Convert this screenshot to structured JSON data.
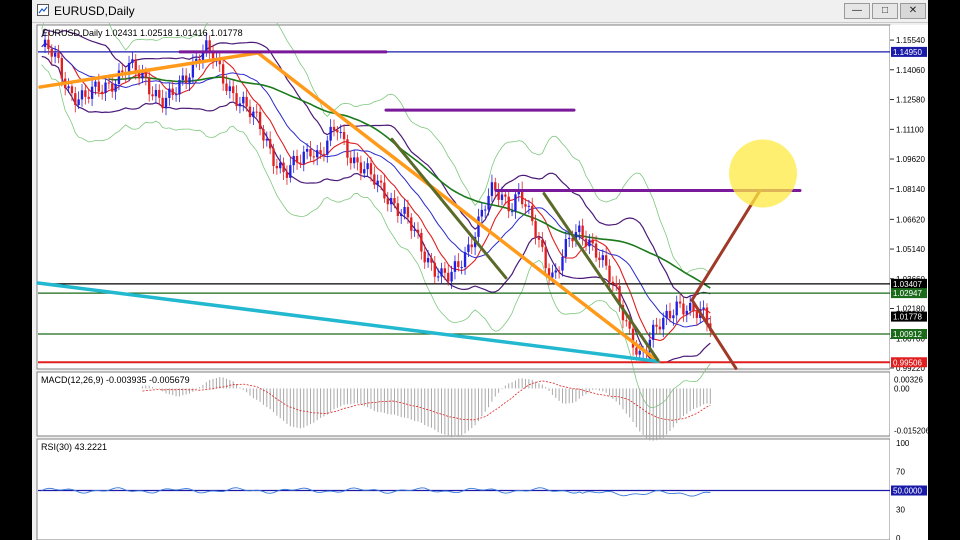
{
  "window": {
    "title": "EURUSD,Daily",
    "buttons": {
      "minimize": "—",
      "restore": "□",
      "close": "✕"
    }
  },
  "chart_data": {
    "type": "candlestick",
    "symbol_header": "EURUSD,Daily  1.02431 1.02518 1.01416 1.01778",
    "price_axis": {
      "ticks": [
        "1.15540",
        "1.14060",
        "1.12580",
        "1.11100",
        "1.09620",
        "1.08140",
        "1.06620",
        "1.05140",
        "1.03660",
        "1.02180",
        "1.00700",
        "0.99220"
      ],
      "range": [
        0.9922,
        1.1604
      ]
    },
    "price_labels": [
      {
        "value": 1.1495,
        "text": "1.14950",
        "color": "#1a1aa8"
      },
      {
        "value": 1.03407,
        "text": "1.03407",
        "color": "#000000"
      },
      {
        "value": 1.02947,
        "text": "1.02947",
        "color": "#1a6a1a"
      },
      {
        "value": 1.01778,
        "text": "1.01778",
        "color": "#000000"
      },
      {
        "value": 1.00912,
        "text": "1.00912",
        "color": "#1a6a1a"
      },
      {
        "value": 0.99506,
        "text": "0.99506",
        "color": "#e02020"
      }
    ],
    "horizontal_lines": [
      {
        "value": 1.1495,
        "color": "#1a1aa8"
      },
      {
        "value": 1.03407,
        "color": "#000000"
      },
      {
        "value": 1.02947,
        "color": "#1a6a1a"
      },
      {
        "value": 1.00912,
        "color": "#1a6a1a"
      },
      {
        "value": 0.99506,
        "color": "#e02020"
      }
    ],
    "close_path": [
      1.152,
      1.149,
      1.142,
      1.132,
      1.128,
      1.126,
      1.129,
      1.132,
      1.135,
      1.138,
      1.141,
      1.139,
      1.136,
      1.13,
      1.124,
      1.126,
      1.134,
      1.141,
      1.148,
      1.15,
      1.144,
      1.136,
      1.13,
      1.124,
      1.118,
      1.114,
      1.105,
      1.095,
      1.087,
      1.092,
      1.098,
      1.103,
      1.097,
      1.104,
      1.112,
      1.103,
      1.096,
      1.091,
      1.086,
      1.082,
      1.078,
      1.072,
      1.066,
      1.058,
      1.05,
      1.044,
      1.038,
      1.036,
      1.043,
      1.052,
      1.062,
      1.072,
      1.08,
      1.078,
      1.074,
      1.08,
      1.068,
      1.058,
      1.046,
      1.038,
      1.048,
      1.056,
      1.06,
      1.057,
      1.05,
      1.04,
      1.03,
      1.02,
      1.008,
      0.996,
      1.004,
      1.014,
      1.02,
      1.024,
      1.02,
      1.018,
      1.022,
      1.016
    ],
    "macd": {
      "label": "MACD(12,26,9) -0.003935 -0.005679",
      "ticks": [
        "0.00326",
        "0.00",
        "-0.015206"
      ],
      "range": [
        -0.0165,
        0.0045
      ]
    },
    "rsi": {
      "label": "RSI(30) 43.2221",
      "ticks": [
        "100",
        "70",
        "50.0000",
        "30",
        "0"
      ],
      "level_label": "50.0000",
      "range": [
        0,
        100
      ]
    }
  }
}
